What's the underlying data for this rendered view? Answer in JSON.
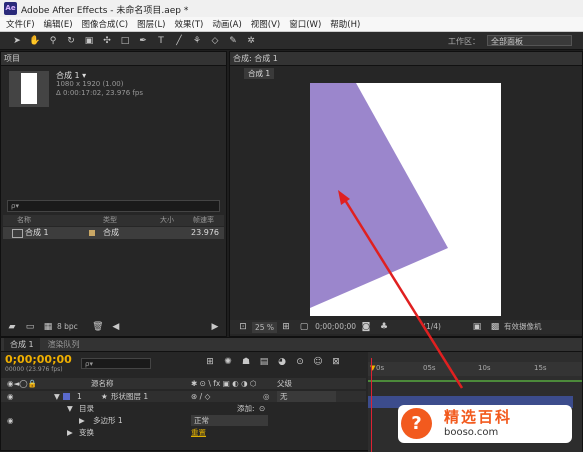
{
  "app": {
    "icon": "Ae",
    "title": "Adobe After Effects - 未命名项目.aep *"
  },
  "menu": [
    "文件(F)",
    "编辑(E)",
    "图像合成(C)",
    "图层(L)",
    "效果(T)",
    "动画(A)",
    "视图(V)",
    "窗口(W)",
    "帮助(H)"
  ],
  "toolbar": {
    "workspace_label": "工作区：",
    "workspace_value": "全部面板"
  },
  "project_panel": {
    "tab": "项目",
    "comp_name": "合成 1 ▾",
    "comp_size": "1080 x 1920 (1.00)",
    "comp_duration": "Δ 0:00:17:02, 23.976 fps",
    "search_placeholder": "ρ▾",
    "columns": [
      "名称",
      "类型",
      "大小",
      "帧速率"
    ],
    "item": {
      "name": "合成 1",
      "type": "合成",
      "fps": "23.976"
    },
    "bpc": "8 bpc"
  },
  "comp_panel": {
    "tab": "合成: 合成 1",
    "subtab": "合成 1",
    "zoom": "25 %",
    "timecode": "0;00;00;00",
    "resolution": "(1/4)",
    "camera": "有效摄像机",
    "shape_color": "#9b86cc"
  },
  "timeline": {
    "tab": "合成 1",
    "tab2": "渲染队列",
    "timecode": "0;00;00;00",
    "frames": "00000 (23.976 fps)",
    "search_placeholder": "ρ▾",
    "col_source": "源名称",
    "col_parent": "父级",
    "layer_index": "1",
    "layer_name": "形状图层 1",
    "parent_value": "无",
    "contents": "目录",
    "add": "添加:",
    "polygon": "多边形 1",
    "blend_mode": "正常",
    "transform": "变换",
    "reset": "重置",
    "ruler": [
      "0s",
      "05s",
      "10s",
      "15s"
    ]
  },
  "watermark": {
    "badge": "?",
    "title": "精选百科",
    "url": "booso.com"
  }
}
